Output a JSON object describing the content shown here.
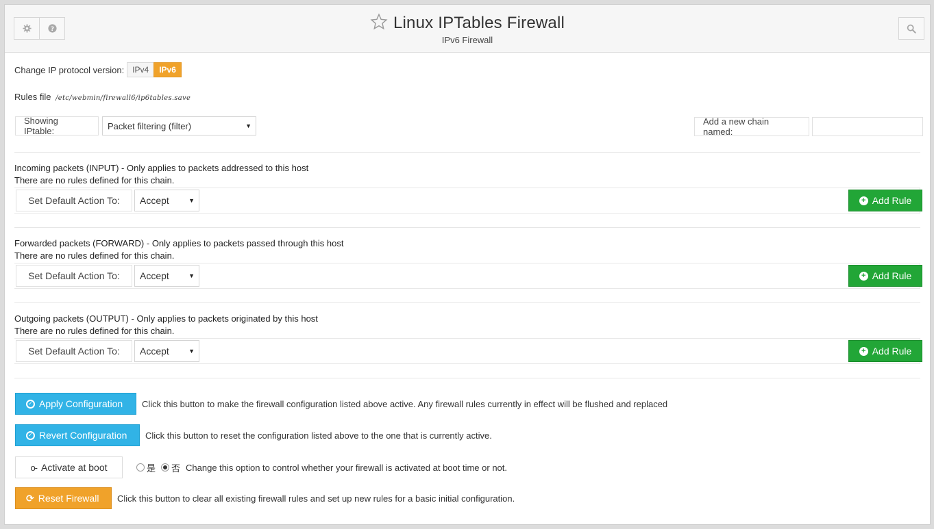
{
  "header": {
    "title": "Linux IPTables Firewall",
    "subtitle": "IPv6 Firewall",
    "left_icons": [
      "gear-icon",
      "help-icon"
    ],
    "right_icon": "search-icon"
  },
  "protocol": {
    "label": "Change IP protocol version:",
    "options": [
      "IPv4",
      "IPv6"
    ],
    "selected": "IPv6"
  },
  "rules_file": {
    "label": "Rules file",
    "path": "/etc/webmin/firewall6/ip6tables.save"
  },
  "iptable": {
    "label": "Showing IPtable:",
    "selected": "Packet filtering (filter)"
  },
  "new_chain": {
    "label": "Add a new chain named:",
    "value": ""
  },
  "chains": [
    {
      "title": "Incoming packets (INPUT) - Only applies to packets addressed to this host",
      "note": "There are no rules defined for this chain.",
      "default_label": "Set Default Action To:",
      "default_value": "Accept",
      "add_label": "Add Rule"
    },
    {
      "title": "Forwarded packets (FORWARD) - Only applies to packets passed through this host",
      "note": "There are no rules defined for this chain.",
      "default_label": "Set Default Action To:",
      "default_value": "Accept",
      "add_label": "Add Rule"
    },
    {
      "title": "Outgoing packets (OUTPUT) - Only applies to packets originated by this host",
      "note": "There are no rules defined for this chain.",
      "default_label": "Set Default Action To:",
      "default_value": "Accept",
      "add_label": "Add Rule"
    }
  ],
  "actions": {
    "apply": {
      "label": "Apply Configuration",
      "desc": "Click this button to make the firewall configuration listed above active. Any firewall rules currently in effect will be flushed and replaced"
    },
    "revert": {
      "label": "Revert Configuration",
      "desc": "Click this button to reset the configuration listed above to the one that is currently active."
    },
    "boot": {
      "label": "Activate at boot",
      "yes": "是",
      "no": "否",
      "selected": "否",
      "desc": "Change this option to control whether your firewall is activated at boot time or not."
    },
    "reset": {
      "label": "Reset Firewall",
      "desc": "Click this button to clear all existing firewall rules and set up new rules for a basic initial configuration."
    }
  },
  "colors": {
    "accent_orange": "#f0a22a",
    "add_green": "#22a637",
    "action_blue": "#31b3e6"
  }
}
